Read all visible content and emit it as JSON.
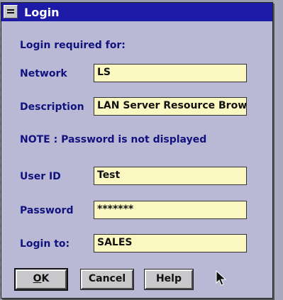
{
  "window": {
    "title": "Login"
  },
  "dialog": {
    "heading": "Login required for:",
    "note": "NOTE : Password is not displayed"
  },
  "fields": {
    "network": {
      "label": "Network",
      "value": "LS"
    },
    "description": {
      "label": "Description",
      "value": "LAN Server Resource Brow"
    },
    "user_id": {
      "label": "User ID",
      "value": "Test"
    },
    "password": {
      "label": "Password",
      "value": "*******"
    },
    "login_to": {
      "label": "Login to:",
      "value": "SALES"
    }
  },
  "buttons": {
    "ok_mnemonic": "O",
    "ok_rest": "K",
    "cancel": "Cancel",
    "help": "Help"
  },
  "icons": {
    "system_menu": "system-menu-icon",
    "cursor": "mouse-pointer-icon"
  },
  "colors": {
    "titlebar": "#1c1aa6",
    "dialog_bg": "#b9b9d6",
    "label_text": "#12127e",
    "field_bg": "#fbf8c2"
  }
}
